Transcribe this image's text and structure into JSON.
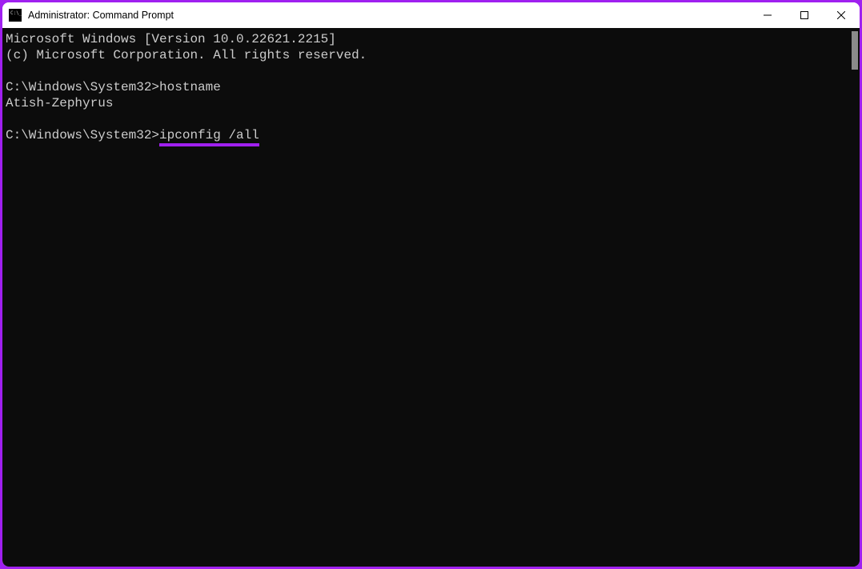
{
  "colors": {
    "accent": "#a020f0",
    "terminal_bg": "#0c0c0c",
    "terminal_fg": "#cccccc"
  },
  "titlebar": {
    "title": "Administrator: Command Prompt"
  },
  "terminal": {
    "header_line_1": "Microsoft Windows [Version 10.0.22621.2215]",
    "header_line_2": "(c) Microsoft Corporation. All rights reserved.",
    "prompt_1": "C:\\Windows\\System32>",
    "command_1": "hostname",
    "output_1": "Atish-Zephyrus",
    "prompt_2": "C:\\Windows\\System32>",
    "command_2": "ipconfig /all"
  }
}
